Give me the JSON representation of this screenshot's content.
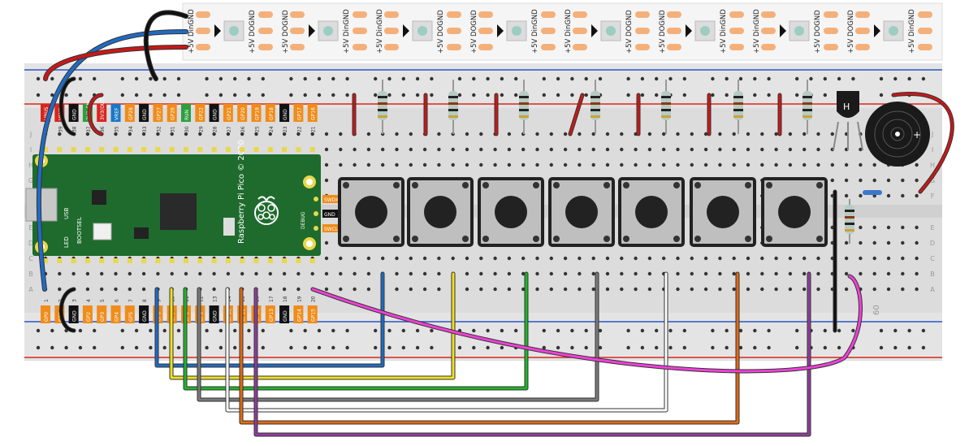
{
  "strip": {
    "labels": [
      "+5V",
      "DIN",
      "GND",
      "+5V",
      "DO",
      "GND"
    ],
    "label_texts": [
      "+5V DinGND",
      "+5V DOGND"
    ],
    "color": "#f5f5f5"
  },
  "pico": {
    "brand": "Raspberry Pi Pico © 2020",
    "usb_label": "USB",
    "led_label": "LED",
    "bootsel_label": "BOOTSEL",
    "debug_label": "DEBUG",
    "board_color": "#1e6b2d",
    "top_pins": [
      {
        "num": "40",
        "label": "VBUS",
        "color": "#d7261e"
      },
      {
        "num": "39",
        "label": "VSYS",
        "color": "#d7261e"
      },
      {
        "num": "38",
        "label": "GND",
        "color": "#111111"
      },
      {
        "num": "37",
        "label": "3V3_EN",
        "color": "#2e9e3e"
      },
      {
        "num": "36",
        "label": "3V3(OUT)",
        "color": "#d7261e"
      },
      {
        "num": "35",
        "label": "VREF",
        "color": "#1b78c7"
      },
      {
        "num": "34",
        "label": "GP28",
        "color": "#f08c1a"
      },
      {
        "num": "33",
        "label": "GND",
        "color": "#111111"
      },
      {
        "num": "32",
        "label": "GP27",
        "color": "#f08c1a"
      },
      {
        "num": "31",
        "label": "GP26",
        "color": "#f08c1a"
      },
      {
        "num": "30",
        "label": "RUN",
        "color": "#2e9e3e"
      },
      {
        "num": "29",
        "label": "GP22",
        "color": "#f08c1a"
      },
      {
        "num": "28",
        "label": "GND",
        "color": "#111111"
      },
      {
        "num": "27",
        "label": "GP21",
        "color": "#f08c1a"
      },
      {
        "num": "26",
        "label": "GP20",
        "color": "#f08c1a"
      },
      {
        "num": "25",
        "label": "GP19",
        "color": "#f08c1a"
      },
      {
        "num": "24",
        "label": "GP18",
        "color": "#f08c1a"
      },
      {
        "num": "23",
        "label": "GND",
        "color": "#111111"
      },
      {
        "num": "22",
        "label": "GP17",
        "color": "#f08c1a"
      },
      {
        "num": "21",
        "label": "GP16",
        "color": "#f08c1a"
      }
    ],
    "bottom_pins": [
      {
        "num": "1",
        "label": "GP0",
        "color": "#f08c1a"
      },
      {
        "num": "2",
        "label": "GP1",
        "color": "#f08c1a"
      },
      {
        "num": "3",
        "label": "GND",
        "color": "#111111"
      },
      {
        "num": "4",
        "label": "GP2",
        "color": "#f08c1a"
      },
      {
        "num": "5",
        "label": "GP3",
        "color": "#f08c1a"
      },
      {
        "num": "6",
        "label": "GP4",
        "color": "#f08c1a"
      },
      {
        "num": "7",
        "label": "GP5",
        "color": "#f08c1a"
      },
      {
        "num": "8",
        "label": "GND",
        "color": "#111111"
      },
      {
        "num": "9",
        "label": "GP6",
        "color": "#f08c1a"
      },
      {
        "num": "10",
        "label": "GP7",
        "color": "#f08c1a"
      },
      {
        "num": "11",
        "label": "GP8",
        "color": "#f08c1a"
      },
      {
        "num": "12",
        "label": "GP9",
        "color": "#f08c1a"
      },
      {
        "num": "13",
        "label": "GND",
        "color": "#111111"
      },
      {
        "num": "14",
        "label": "GP10",
        "color": "#f08c1a"
      },
      {
        "num": "15",
        "label": "GP11",
        "color": "#f08c1a"
      },
      {
        "num": "16",
        "label": "GP12",
        "color": "#f08c1a"
      },
      {
        "num": "17",
        "label": "GP13",
        "color": "#f08c1a"
      },
      {
        "num": "18",
        "label": "GND",
        "color": "#111111"
      },
      {
        "num": "19",
        "label": "GP14",
        "color": "#f08c1a"
      },
      {
        "num": "20",
        "label": "GP15",
        "color": "#f08c1a"
      }
    ],
    "debug_pins": [
      {
        "label": "SWDIO",
        "color": "#f08c1a"
      },
      {
        "label": "GND",
        "color": "#111111"
      },
      {
        "label": "SWCLK",
        "color": "#f08c1a"
      }
    ]
  },
  "breadboard": {
    "row_letters_top": [
      "J",
      "I",
      "H",
      "G",
      "F"
    ],
    "row_letters_bottom": [
      "E",
      "D",
      "C",
      "B",
      "A"
    ],
    "column_marker": "60",
    "rail_red": "#d7261e",
    "rail_blue": "#2a56c6"
  },
  "components": {
    "button_count": 7,
    "resistor_count": 8,
    "buzzer_label": "+",
    "transistor_label": "H"
  },
  "wires": {
    "blue": "#1f6bc4",
    "red": "#c81818",
    "black": "#111111",
    "yellow": "#f0e020",
    "green": "#1fb52a",
    "gray": "#7a7a7a",
    "white": "#ffffff",
    "orange": "#e06a10",
    "purple": "#8e3d9a",
    "magenta": "#f040d8"
  }
}
